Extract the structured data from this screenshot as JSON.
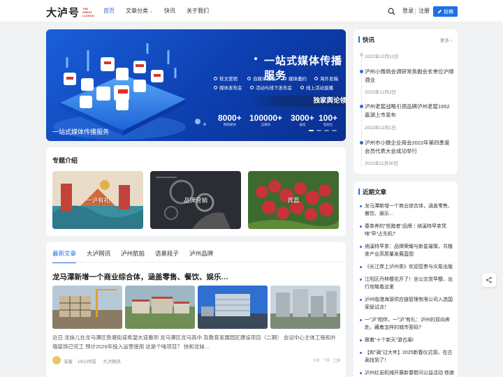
{
  "header": {
    "logo": "大泸号",
    "logo_sub": "THE GREAT LUZHOU",
    "nav": [
      {
        "label": "首页"
      },
      {
        "label": "文章分类"
      },
      {
        "label": "快讯"
      },
      {
        "label": "关于我们"
      }
    ],
    "login": "登录",
    "register": "注册",
    "post": "投稿"
  },
  "banner": {
    "title": "一站式媒体传播服务",
    "features": [
      "软文营销",
      "自媒体发稿",
      "媒体邀约",
      "海外发稿",
      "媒体发布会",
      "活动与线下发布会",
      "线上活动直播"
    ],
    "club": "独家舆论领袖俱乐部",
    "stats": [
      {
        "num": "8000+",
        "label": "网络媒体"
      },
      {
        "num": "100000+",
        "label": "自媒体"
      },
      {
        "num": "3000+",
        "label": "报纸"
      },
      {
        "num": "100+",
        "label": "电视台"
      }
    ],
    "caption": "一站式媒体传播服务"
  },
  "topics": {
    "title": "专题介绍",
    "items": [
      {
        "label": "一泸有礼"
      },
      {
        "label": "品牌营销"
      },
      {
        "label": "宾荔"
      }
    ]
  },
  "latest": {
    "tabs": [
      "最新文章",
      "大泸网讯",
      "泸州航拍",
      "语景段子",
      "泸州品牌"
    ],
    "article": {
      "title": "龙马潭新增一个商业综合体，涵盖零售、餐饮、娱乐…",
      "desc": "近日 龙妹儿在龙马潭区鱼塘街道希望大道看到 龙马潭区龙马高中 及教育发展园区建设项目（二期） 会议中心主体工程和外墙装饰已完工 预计2026年投入运营使用 这是个啥项目？ 快和龙妹…",
      "author": "深客",
      "time": "19小时前",
      "category": "大泸网讯",
      "views": "0",
      "likes": "0",
      "comments": "0"
    }
  },
  "news": {
    "title": "快讯",
    "more": "更多",
    "items": [
      {
        "date": "2022年12月12日",
        "text": "泸州小微商会调研常务副会长单位沪顺酒业"
      },
      {
        "date": "2022年12月3日",
        "text": "泸州老窖战略引领品牌泸州老窖1952嘉湖上市发布"
      },
      {
        "date": "2022年12月1日",
        "text": "泸州市小微企业商会2022年第四季度会员代表大会成功举行"
      },
      {
        "date": "2022年11月30日",
        "text": ""
      }
    ]
  },
  "recent": {
    "title": "近期文章",
    "items": [
      "龙马潭新增一个商业综合体，涵盖零售、餐饮、娱乐…",
      "春茶养的\"抢跑者\"品牌｜纳溪特早茶凭啥\"早\"占先机?",
      "纳溪特早茶：品牌荣耀与新星璀璨，共植茶产业高质量发展蓝图",
      "《长江岸上泸州茶》欢迎您参与众筹出版",
      "江阳区丹林樱花开了！坐公交赏早樱，出行攻略看这里",
      "泸州临港海源供应链管理有限公司入选国家级试点！",
      "一\"泸\"相伴，一\"泸\"有礼：泸州的双向奔赴，藏着怎样的城市密码?",
      "跟着\"十个新天\"游古蔺!",
      "【和\"蔺\"过大年】2025新春仪式感，在古蔺找到了！",
      "泸州红岩机械开展新春慰问公益活动 铁娘子手勤舞传递温暖与新"
    ]
  }
}
